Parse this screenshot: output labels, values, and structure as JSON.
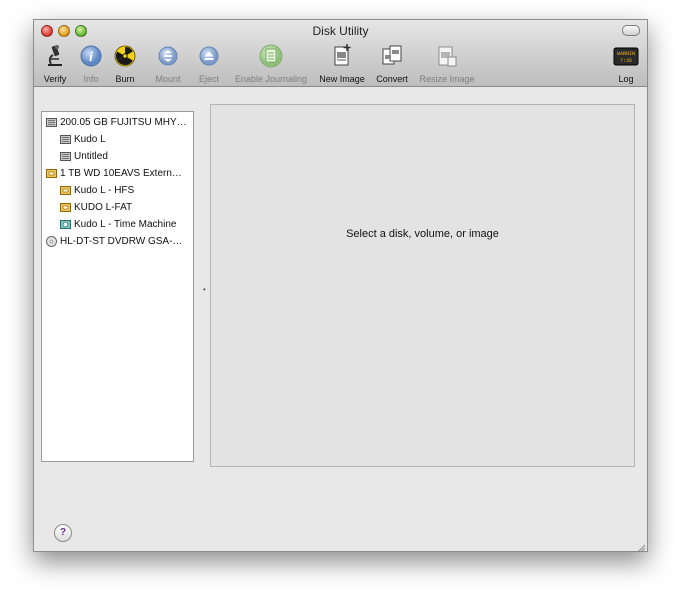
{
  "window": {
    "title": "Disk Utility"
  },
  "toolbar": {
    "verify": "Verify",
    "info": "Info",
    "burn": "Burn",
    "mount": "Mount",
    "eject": "Eject",
    "enable_journaling": "Enable Journaling",
    "new_image": "New Image",
    "convert": "Convert",
    "resize_image": "Resize Image",
    "log": "Log",
    "log_icon_text": "WARNIN\n7:36"
  },
  "sidebar": {
    "items": [
      {
        "label": "200.05 GB FUJITSU MHY…",
        "icon": "internal-disk-icon"
      },
      {
        "label": "Kudo L",
        "icon": "volume-icon"
      },
      {
        "label": "Untitled",
        "icon": "volume-icon"
      },
      {
        "label": "1 TB WD 10EAVS Extern…",
        "icon": "external-disk-icon"
      },
      {
        "label": "Kudo L - HFS",
        "icon": "external-volume-icon"
      },
      {
        "label": "KUDO L-FAT",
        "icon": "external-volume-icon"
      },
      {
        "label": "Kudo L - Time Machine",
        "icon": "time-machine-volume-icon"
      },
      {
        "label": "HL-DT-ST DVDRW GSA-…",
        "icon": "optical-drive-icon"
      }
    ]
  },
  "detail": {
    "message": "Select a disk, volume, or image"
  },
  "help": {
    "label": "?"
  }
}
